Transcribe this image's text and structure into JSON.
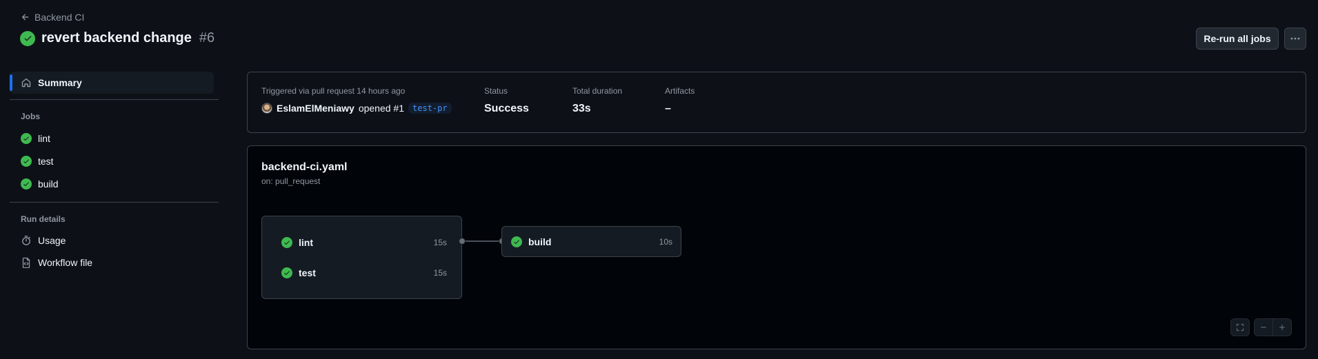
{
  "header": {
    "back_label": "Backend CI",
    "title": "revert backend change",
    "run_number": "#6",
    "rerun_label": "Re-run all jobs"
  },
  "sidebar": {
    "summary_label": "Summary",
    "jobs_heading": "Jobs",
    "jobs": [
      {
        "label": "lint",
        "status": "success"
      },
      {
        "label": "test",
        "status": "success"
      },
      {
        "label": "build",
        "status": "success"
      }
    ],
    "run_details_heading": "Run details",
    "run_details": [
      {
        "label": "Usage",
        "icon": "stopwatch-icon"
      },
      {
        "label": "Workflow file",
        "icon": "file-code-icon"
      }
    ]
  },
  "summary": {
    "trigger_label": "Triggered via pull request 14 hours ago",
    "trigger_user": "EslamElMeniawy",
    "trigger_action": "opened #1",
    "branch": "test-pr",
    "status_label": "Status",
    "status_value": "Success",
    "duration_label": "Total duration",
    "duration_value": "33s",
    "artifacts_label": "Artifacts",
    "artifacts_value": "–"
  },
  "workflow": {
    "file": "backend-ci.yaml",
    "trigger": "on: pull_request",
    "group_jobs": [
      {
        "name": "lint",
        "duration": "15s"
      },
      {
        "name": "test",
        "duration": "15s"
      }
    ],
    "downstream_job": {
      "name": "build",
      "duration": "10s"
    }
  },
  "colors": {
    "success": "#3fb950",
    "accent": "#1f6feb",
    "background": "#0d1117"
  }
}
